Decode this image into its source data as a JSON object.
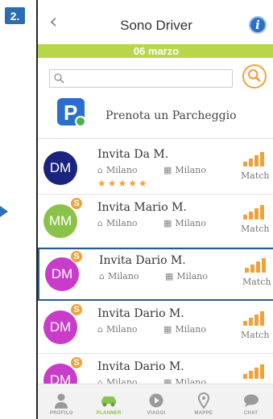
{
  "step": {
    "label": "2."
  },
  "header": {
    "title": "Sono Driver",
    "back_icon": "chevron-left-icon",
    "info_icon": "info-icon"
  },
  "date_bar": {
    "text": "06 marzo",
    "color": "#b7d64b"
  },
  "search": {
    "placeholder": "",
    "value": ""
  },
  "parking": {
    "label": "Prenota un Parcheggio"
  },
  "rides": [
    {
      "initials": "DM",
      "name": "Invita Da M.",
      "from": "Milano",
      "to": "Milano",
      "match": "Match",
      "stars": "★★★★★",
      "coin": "",
      "avatar_color": "#1a237e",
      "selected": false
    },
    {
      "initials": "MM",
      "name": "Invita Mario M.",
      "from": "Milano",
      "to": "Milano",
      "match": "Match",
      "stars": "",
      "coin": "S",
      "avatar_color": "#8bc34a",
      "selected": false
    },
    {
      "initials": "DM",
      "name": "Invita Dario M.",
      "from": "Milano",
      "to": "Milano",
      "match": "Match",
      "stars": "",
      "coin": "S",
      "avatar_color": "#c93bc9",
      "selected": true
    },
    {
      "initials": "DM",
      "name": "Invita Dario M.",
      "from": "Milano",
      "to": "Milano",
      "match": "Match",
      "stars": "",
      "coin": "S",
      "avatar_color": "#c93bc9",
      "selected": false
    },
    {
      "initials": "DM",
      "name": "Invita Dario M.",
      "from": "Milano",
      "to": "Milano",
      "match": "Match",
      "stars": "",
      "coin": "S",
      "avatar_color": "#c93bc9",
      "selected": false
    }
  ],
  "tabs": [
    {
      "label": "PROFILO",
      "icon": "user-icon",
      "active": false
    },
    {
      "label": "PLANNER",
      "icon": "car-icon",
      "active": true
    },
    {
      "label": "VIAGGI",
      "icon": "play-icon",
      "active": false
    },
    {
      "label": "MAPPE",
      "icon": "map-pin-icon",
      "active": false
    },
    {
      "label": "CHAT",
      "icon": "chat-bubble-icon",
      "active": false
    }
  ],
  "colors": {
    "accent_orange": "#f0a23a",
    "accent_blue": "#2a6fc9",
    "accent_green": "#8bc34a"
  }
}
